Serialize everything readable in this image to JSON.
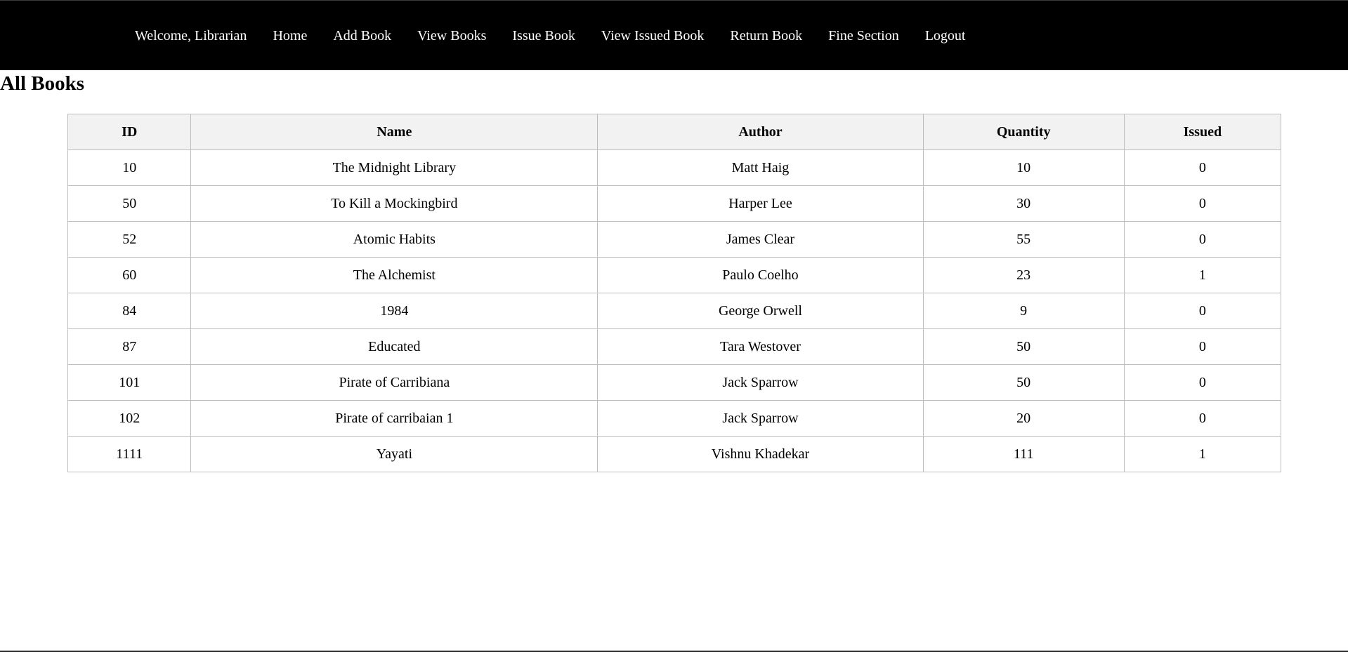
{
  "nav": {
    "welcome": "Welcome, Librarian",
    "items": [
      {
        "label": "Home"
      },
      {
        "label": "Add Book"
      },
      {
        "label": "View Books"
      },
      {
        "label": "Issue Book"
      },
      {
        "label": "View Issued Book"
      },
      {
        "label": "Return Book"
      },
      {
        "label": "Fine Section"
      },
      {
        "label": "Logout"
      }
    ]
  },
  "page": {
    "title": "All Books"
  },
  "table": {
    "headers": [
      "ID",
      "Name",
      "Author",
      "Quantity",
      "Issued"
    ],
    "rows": [
      [
        "10",
        "The Midnight Library",
        "Matt Haig",
        "10",
        "0"
      ],
      [
        "50",
        "To Kill a Mockingbird",
        "Harper Lee",
        "30",
        "0"
      ],
      [
        "52",
        "Atomic Habits",
        "James Clear",
        "55",
        "0"
      ],
      [
        "60",
        "The Alchemist",
        "Paulo Coelho",
        "23",
        "1"
      ],
      [
        "84",
        "1984",
        "George Orwell",
        "9",
        "0"
      ],
      [
        "87",
        "Educated",
        "Tara Westover",
        "50",
        "0"
      ],
      [
        "101",
        "Pirate of Carribiana",
        "Jack Sparrow",
        "50",
        "0"
      ],
      [
        "102",
        "Pirate of carribaian 1",
        "Jack Sparrow",
        "20",
        "0"
      ],
      [
        "1111",
        "Yayati",
        "Vishnu Khadekar",
        "111",
        "1"
      ]
    ]
  },
  "colors": {
    "navbar_bg": "#000000",
    "nav_text": "#ffffff",
    "header_bg": "#f2f2f2",
    "border": "#bdbdbd"
  }
}
